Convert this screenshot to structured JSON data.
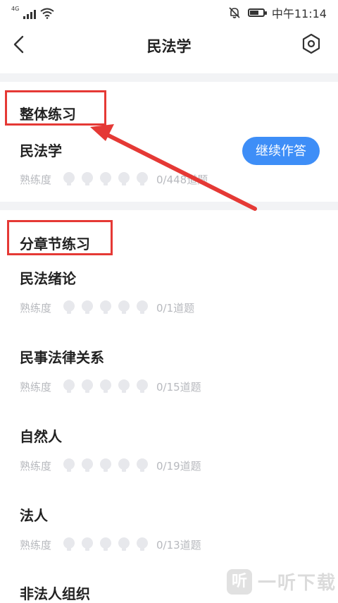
{
  "status_bar": {
    "network": "4G",
    "time": "中午11:14"
  },
  "header": {
    "title": "民法学"
  },
  "overall": {
    "section_title": "整体练习",
    "item_title": "民法学",
    "continue_label": "继续作答",
    "progress_label": "熟练度",
    "progress_text": "0/448道题"
  },
  "chapters": {
    "section_title": "分章节练习",
    "items": [
      {
        "title": "民法绪论",
        "progress_label": "熟练度",
        "progress_text": "0/1道题"
      },
      {
        "title": "民事法律关系",
        "progress_label": "熟练度",
        "progress_text": "0/15道题"
      },
      {
        "title": "自然人",
        "progress_label": "熟练度",
        "progress_text": "0/19道题"
      },
      {
        "title": "法人",
        "progress_label": "熟练度",
        "progress_text": "0/13道题"
      },
      {
        "title": "非法人组织"
      }
    ]
  },
  "watermark": {
    "logo": "听",
    "text": "一听下载"
  },
  "colors": {
    "accent": "#3e8ef7",
    "highlight": "#e53935",
    "muted_text": "#b7b9be"
  }
}
